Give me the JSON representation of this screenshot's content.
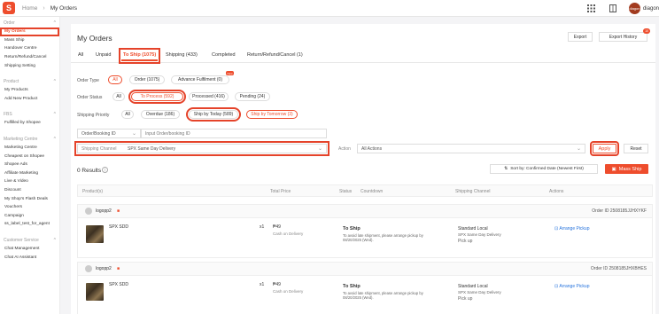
{
  "topbar": {
    "logo": "S",
    "breadcrumb_home": "Home",
    "breadcrumb_sep": "›",
    "breadcrumb_current": "My Orders",
    "user_name": "diagon",
    "avatar_text": "diagon"
  },
  "sidebar": {
    "sections": [
      {
        "title": "Order",
        "items": [
          "My Orders",
          "Mass Ship",
          "Handover Centre",
          "Return/Refund/Cancel",
          "Shipping Setting"
        ]
      },
      {
        "title": "Product",
        "items": [
          "My Products",
          "Add New Product"
        ]
      },
      {
        "title": "FBS",
        "items": [
          "Fulfilled by Shopee"
        ]
      },
      {
        "title": "Marketing Centre",
        "items": [
          "Marketing Centre",
          "Cheapest on Shopee",
          "Shopee Ads",
          "Affiliate Marketing",
          "Live & Video",
          "Discount",
          "My Shop's Flash Deals",
          "Vouchers",
          "Campaign",
          "ss_label_test_for_agent"
        ]
      },
      {
        "title": "Customer Service",
        "items": [
          "Chat Management",
          "Chat AI Assistant"
        ]
      }
    ]
  },
  "header": {
    "title": "My Orders",
    "export_label": "Export",
    "export_history_label": "Export History",
    "export_history_badge": "10"
  },
  "tabs": [
    "All",
    "Unpaid",
    "To Ship (1075)",
    "Shipping (433)",
    "Completed",
    "Return/Refund/Cancel (1)"
  ],
  "filters": {
    "order_type_label": "Order Type",
    "order_type": [
      "All",
      "Order (1075)",
      "Advance Fulfilment (0)"
    ],
    "new_tag": "New",
    "order_status_label": "Order Status",
    "order_status": [
      "All",
      "To Process (592)",
      "Processed (416)",
      "Pending (24)"
    ],
    "shipping_priority_label": "Shipping Priority",
    "shipping_priority": [
      "All",
      "Overdue (186)",
      "Ship by Today (589)",
      "Ship by Tomorrow (3)"
    ],
    "search_type": "Order/Booking ID",
    "search_placeholder": "Input Order/booking ID",
    "shipping_channel_label": "Shipping Channel",
    "shipping_channel_value": "SPX Same Day Delivery",
    "action_label": "Action",
    "action_value": "All Actions",
    "apply_label": "Apply",
    "reset_label": "Reset"
  },
  "results": {
    "count_label": "0 Results",
    "sort_label": "Sort by: Confirmed Date (Newest First)",
    "mass_ship_label": "Mass Ship"
  },
  "table_headers": [
    "Product(s)",
    "Total Price",
    "Status",
    "Countdown",
    "Shipping Channel",
    "Actions"
  ],
  "orders": [
    {
      "buyer": "logopp2",
      "order_id": "Order ID 2508185JJHXYKF",
      "product_name": "SPX SDD",
      "qty": "x1",
      "price": "₱49",
      "payment": "Cash on Delivery",
      "status": "To Ship",
      "status_note": "To avoid late shipment, please arrange pickup by 08/20/2025 (Wed).",
      "channel": "Standard Local",
      "channel_sub": "SPX Same Day Delivery",
      "channel_method": "Pick up",
      "action": "Arrange Pickup"
    },
    {
      "buyer": "logopp2",
      "order_id": "Order ID 2508185JHXBHES",
      "product_name": "SPX SDD",
      "qty": "x1",
      "price": "₱49",
      "payment": "Cash on Delivery",
      "status": "To Ship",
      "status_note": "To avoid late shipment, please arrange pickup by 08/20/2025 (Wed).",
      "channel": "Standard Local",
      "channel_sub": "SPX Same Day Delivery",
      "channel_method": "Pick up",
      "action": "Arrange Pickup"
    }
  ]
}
